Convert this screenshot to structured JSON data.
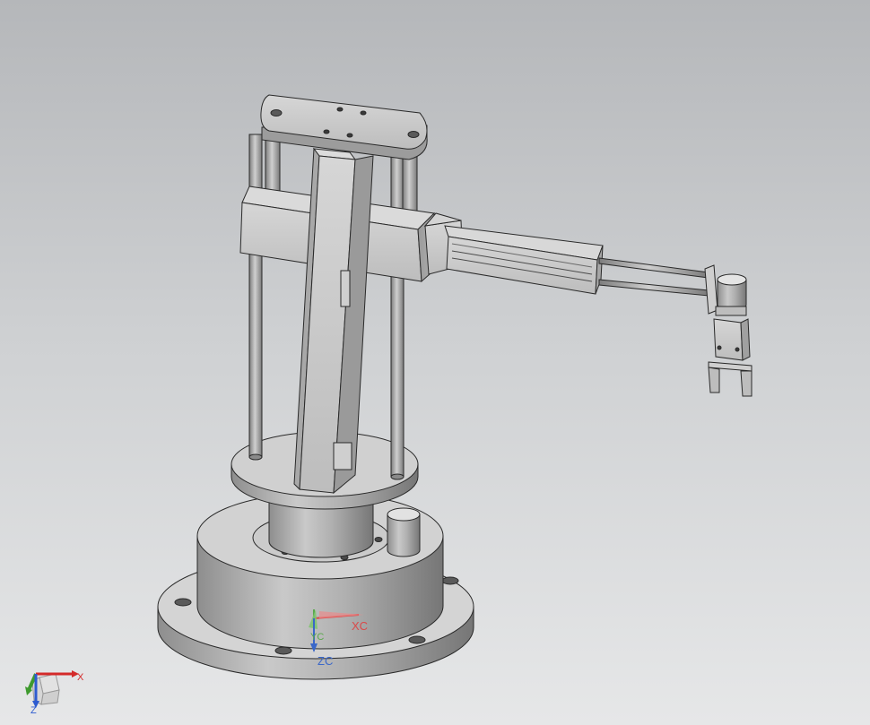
{
  "viewport": {
    "background_top": "#b5b7ba",
    "background_bottom": "#e6e7e8"
  },
  "wcs_triad": {
    "x_label": "XC",
    "y_label": "YC",
    "z_label": "ZC",
    "x_color": "#d94a4a",
    "y_color": "#5aa84c",
    "z_color": "#3a67c9"
  },
  "view_triad": {
    "x_label": "X",
    "z_label": "Z",
    "x_color": "#d42a2a",
    "y_color": "#3e9a2e",
    "z_color": "#2d5bd0"
  },
  "model": {
    "part_color": "#c4c4c4",
    "edge_color": "#2a2a2a",
    "icon": "robot-arm-model"
  }
}
